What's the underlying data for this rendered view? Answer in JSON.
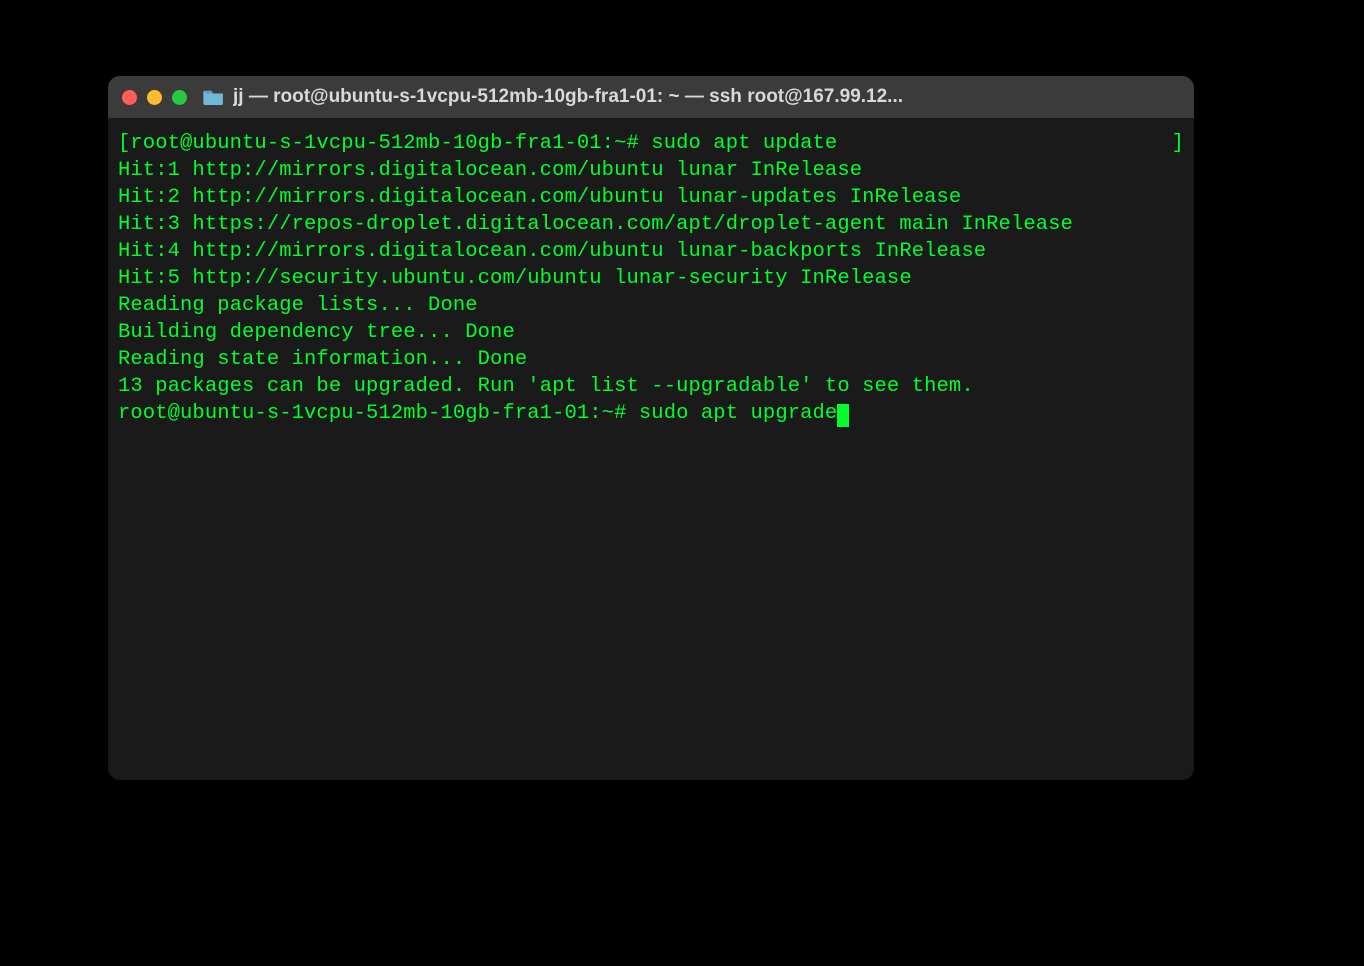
{
  "window": {
    "title": "jj — root@ubuntu-s-1vcpu-512mb-10gb-fra1-01: ~ — ssh root@167.99.12..."
  },
  "terminal": {
    "first_prompt_open": "[",
    "first_prompt": "root@ubuntu-s-1vcpu-512mb-10gb-fra1-01:~# ",
    "first_command": "sudo apt update",
    "first_prompt_close": "]",
    "lines": [
      "Hit:1 http://mirrors.digitalocean.com/ubuntu lunar InRelease",
      "Hit:2 http://mirrors.digitalocean.com/ubuntu lunar-updates InRelease",
      "Hit:3 https://repos-droplet.digitalocean.com/apt/droplet-agent main InRelease",
      "Hit:4 http://mirrors.digitalocean.com/ubuntu lunar-backports InRelease",
      "Hit:5 http://security.ubuntu.com/ubuntu lunar-security InRelease",
      "Reading package lists... Done",
      "Building dependency tree... Done",
      "Reading state information... Done",
      "13 packages can be upgraded. Run 'apt list --upgradable' to see them."
    ],
    "second_prompt": "root@ubuntu-s-1vcpu-512mb-10gb-fra1-01:~# ",
    "second_command": "sudo apt upgrade"
  }
}
